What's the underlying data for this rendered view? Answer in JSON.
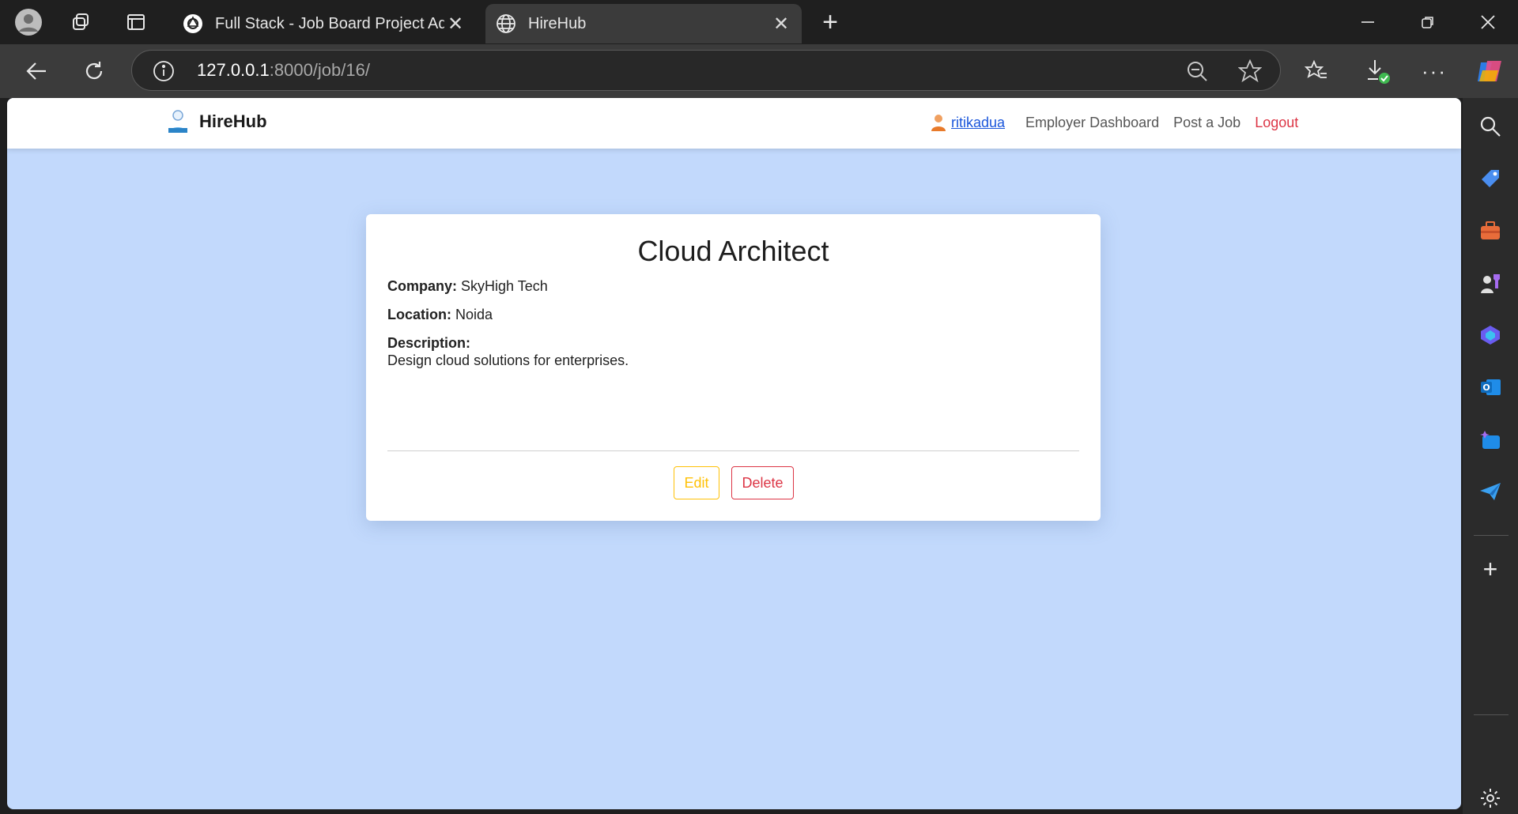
{
  "browser": {
    "tabs": [
      {
        "title": "Full Stack - Job Board Project Adv",
        "icon": "chatgpt-icon"
      },
      {
        "title": "HireHub",
        "icon": "globe-icon"
      }
    ],
    "url_host": "127.0.0.1",
    "url_path": ":8000/job/16/"
  },
  "app": {
    "brand": "HireHub",
    "nav": {
      "username": "ritikadua",
      "employer_dashboard": "Employer Dashboard",
      "post_job": "Post a Job",
      "logout": "Logout"
    }
  },
  "job": {
    "title": "Cloud Architect",
    "company_label": "Company:",
    "company": "SkyHigh Tech",
    "location_label": "Location:",
    "location": "Noida",
    "description_label": "Description:",
    "description": "Design cloud solutions for enterprises.",
    "edit_label": "Edit",
    "delete_label": "Delete"
  },
  "colors": {
    "page_bg": "#c2d9fc",
    "edit": "#ffc107",
    "delete": "#dc3545",
    "link": "#1a56db"
  }
}
